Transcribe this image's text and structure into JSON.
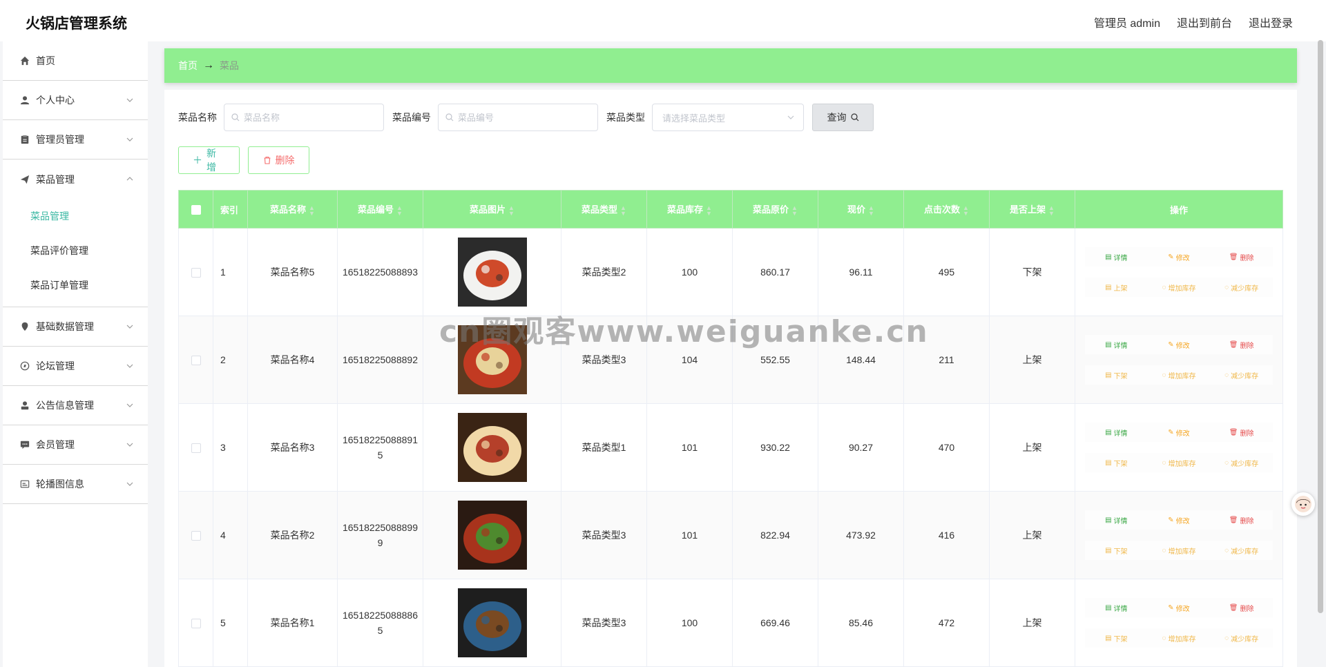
{
  "app": {
    "title": "火锅店管理系统"
  },
  "header": {
    "user_label": "管理员 admin",
    "to_front": "退出到前台",
    "logout": "退出登录"
  },
  "sidebar": {
    "items": [
      {
        "label": "首页",
        "icon": "home-icon"
      },
      {
        "label": "个人中心",
        "icon": "user-icon"
      },
      {
        "label": "管理员管理",
        "icon": "clipboard-icon"
      },
      {
        "label": "菜品管理",
        "icon": "paper-plane-icon"
      },
      {
        "label": "基础数据管理",
        "icon": "location-pin-icon"
      },
      {
        "label": "论坛管理",
        "icon": "compass-icon"
      },
      {
        "label": "公告信息管理",
        "icon": "person-icon"
      },
      {
        "label": "会员管理",
        "icon": "chat-icon"
      },
      {
        "label": "轮播图信息",
        "icon": "image-icon"
      }
    ],
    "submenu": [
      {
        "label": "菜品管理"
      },
      {
        "label": "菜品评价管理"
      },
      {
        "label": "菜品订单管理"
      }
    ]
  },
  "breadcrumb": {
    "home": "首页",
    "arrow": "→",
    "current": "菜品"
  },
  "search": {
    "name_label": "菜品名称",
    "name_placeholder": "菜品名称",
    "code_label": "菜品编号",
    "code_placeholder": "菜品编号",
    "type_label": "菜品类型",
    "type_placeholder": "请选择菜品类型",
    "query_label": "查询"
  },
  "actions": {
    "add_label": "新增",
    "delete_label": "删除"
  },
  "table": {
    "headers": [
      "索引",
      "菜品名称",
      "菜品编号",
      "菜品图片",
      "菜品类型",
      "菜品库存",
      "菜品原价",
      "现价",
      "点击次数",
      "是否上架",
      "操作"
    ],
    "ops": {
      "detail": "详情",
      "edit": "修改",
      "delete": "删除",
      "add_stock": "增加库存",
      "reduce_stock": "减少库存"
    },
    "rows": [
      {
        "index": "1",
        "name": "菜品名称5",
        "code": "16518225088893",
        "type": "菜品类型2",
        "stock": "100",
        "price": "860.17",
        "current": "96.11",
        "clicks": "495",
        "shelf": "下架",
        "toggle": "上架",
        "colors": [
          "#f2f2f0",
          "#cf4a2a",
          "#2b2b2b"
        ]
      },
      {
        "index": "2",
        "name": "菜品名称4",
        "code": "16518225088892",
        "type": "菜品类型3",
        "stock": "104",
        "price": "552.55",
        "current": "148.44",
        "clicks": "211",
        "shelf": "上架",
        "toggle": "下架",
        "colors": [
          "#c23a22",
          "#e8d39a",
          "#5c3a20"
        ]
      },
      {
        "index": "3",
        "name": "菜品名称3",
        "code": "165182250888915",
        "type": "菜品类型1",
        "stock": "101",
        "price": "930.22",
        "current": "90.27",
        "clicks": "470",
        "shelf": "上架",
        "toggle": "下架",
        "colors": [
          "#f1d9a8",
          "#b5402a",
          "#3a2414"
        ]
      },
      {
        "index": "4",
        "name": "菜品名称2",
        "code": "165182250888999",
        "type": "菜品类型3",
        "stock": "101",
        "price": "822.94",
        "current": "473.92",
        "clicks": "416",
        "shelf": "上架",
        "toggle": "下架",
        "colors": [
          "#a8331c",
          "#4e8a2e",
          "#2a1a12"
        ]
      },
      {
        "index": "5",
        "name": "菜品名称1",
        "code": "165182250888865",
        "type": "菜品类型3",
        "stock": "100",
        "price": "669.46",
        "current": "85.46",
        "clicks": "472",
        "shelf": "上架",
        "toggle": "下架",
        "colors": [
          "#2d5f8a",
          "#7a4a22",
          "#1e1e1e"
        ]
      }
    ]
  },
  "watermark": "cn圈观客www.weiguanke.cn",
  "accent": "#90ee90"
}
